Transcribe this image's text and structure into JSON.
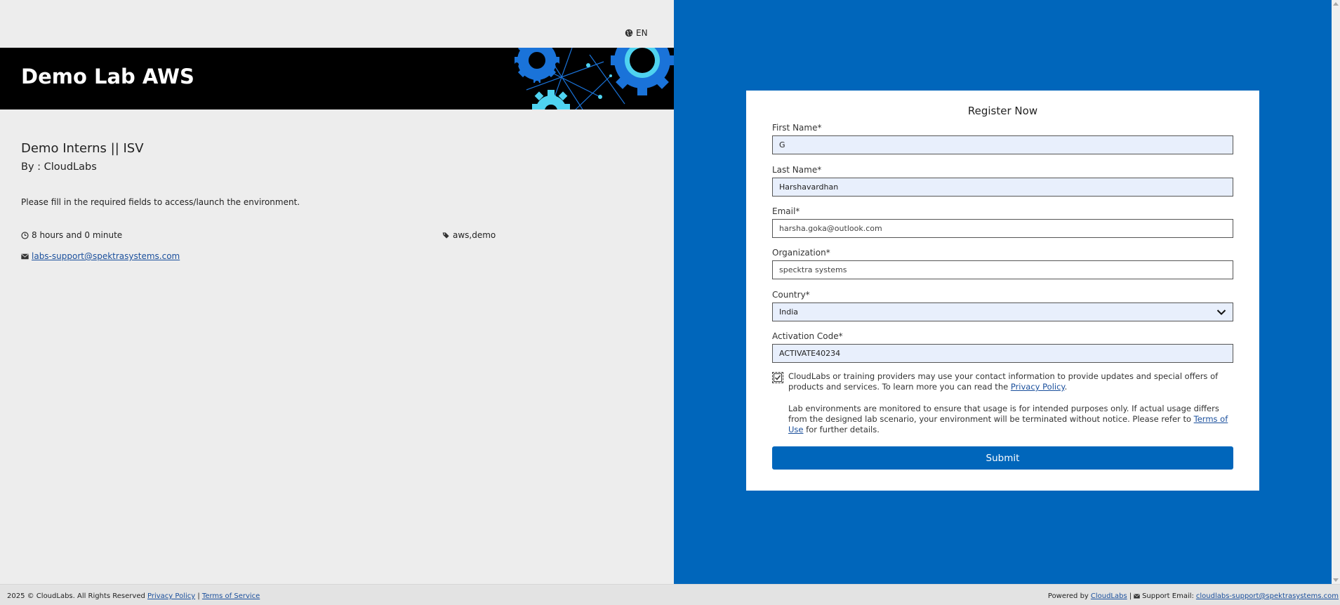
{
  "header": {
    "language": "EN",
    "banner_title": "Demo Lab AWS"
  },
  "lab": {
    "title": "Demo Interns || ISV",
    "by": "By : CloudLabs",
    "description": "Please fill in the required fields to access/launch the environment.",
    "duration": "8 hours and 0 minute",
    "tags": "aws,demo",
    "support_email": " labs-support@spektrasystems.com"
  },
  "form": {
    "title": "Register Now",
    "first_name": {
      "label": "First Name*",
      "value": "G"
    },
    "last_name": {
      "label": "Last Name*",
      "value": "Harshavardhan"
    },
    "email": {
      "label": "Email*",
      "value": "harsha.goka@outlook.com"
    },
    "organization": {
      "label": "Organization*",
      "value": "specktra systems"
    },
    "country": {
      "label": "Country*",
      "value": "India"
    },
    "activation_code": {
      "label": "Activation Code*",
      "value": "ACTIVATE40234"
    },
    "consent_text": "CloudLabs or training providers may use your contact information to provide updates and special offers of products and services. To learn more you can read the ",
    "privacy_link": "Privacy Policy",
    "consent_end": ".",
    "monitor_text": "Lab environments are monitored to ensure that usage is for intended purposes only. If actual usage differs from the designed lab scenario, your environment will be terminated without notice. Please refer to ",
    "terms_link": "Terms of Use",
    "monitor_end": " for further details.",
    "submit_label": "Submit"
  },
  "footer": {
    "copyright": "2025 © CloudLabs. All Rights Reserved ",
    "privacy": "Privacy Policy",
    "sep1": " | ",
    "terms": "Terms of Service",
    "powered": "Powered by ",
    "powered_link": "CloudLabs",
    "sep2": " | ",
    "support_label": "Support Email:",
    "support_email": "cloudlabs-support@spektrasystems.com"
  },
  "icons": {
    "globe": "globe-icon",
    "clock": "clock-icon",
    "tags": "tags-icon",
    "envelope": "envelope-icon",
    "chevron": "chevron-down-icon",
    "check": "check-icon"
  },
  "colors": {
    "primary": "#0066bb",
    "banner": "#000000",
    "input_fill": "#e8effc",
    "gear_blue": "#1a73d9",
    "gear_cyan": "#4fd3f0"
  }
}
